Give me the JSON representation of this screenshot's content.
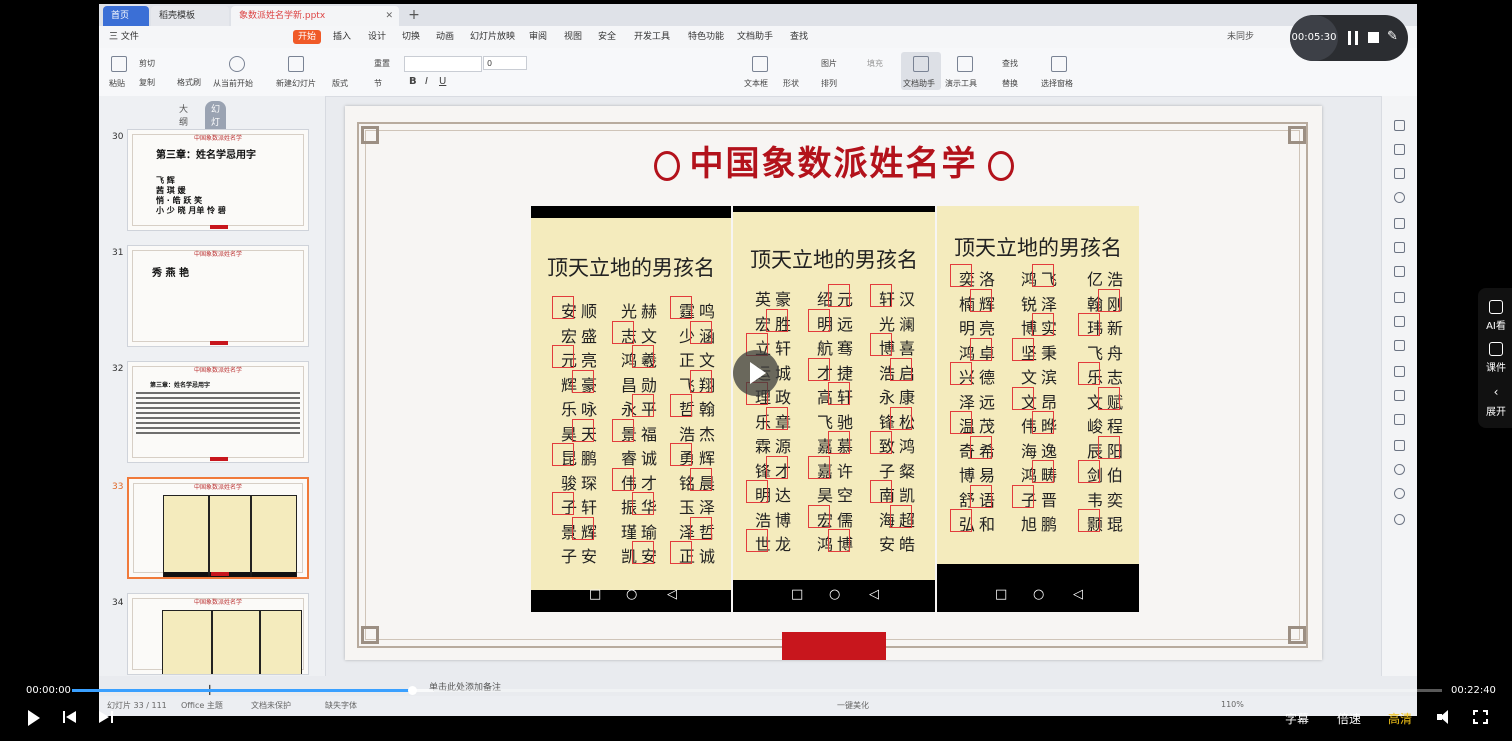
{
  "tabs": {
    "home": "首页",
    "wps": "稻壳模板",
    "doc": "象数派姓名学新.pptx"
  },
  "menu": [
    "三 文件",
    "开始",
    "插入",
    "设计",
    "切换",
    "动画",
    "幻灯片放映",
    "审阅",
    "视图",
    "安全",
    "开发工具",
    "特色功能",
    "文档助手",
    "查找"
  ],
  "menu_right": "未同步",
  "ribbon": {
    "paste": "粘贴",
    "cut": "剪切",
    "copy": "复制",
    "format": "格式刷",
    "from_start": "从当前开始",
    "new_slide": "新建幻灯片",
    "layout": "版式",
    "section": "节",
    "reset": "重置",
    "font_size": "0",
    "textbox": "文本框",
    "shape": "形状",
    "arrange": "排列",
    "picture": "图片",
    "fill": "填充",
    "doc_assist": "文档助手",
    "present_tools": "演示工具",
    "find": "查找",
    "replace": "替换",
    "select_pane": "选择窗格"
  },
  "panel": {
    "outline": "大纲",
    "slides": "幻灯片"
  },
  "thumbs": [
    {
      "num": "30",
      "title": "中国象数派姓名学",
      "text": [
        "第三章：姓名学忌用字",
        "",
        "飞 辉",
        "茜 琪 媛",
        "悄 · 皓 跃 笑",
        "小 少 晓 月单 怜 碧"
      ]
    },
    {
      "num": "31",
      "title": "中国象数派姓名学",
      "text": [
        "秀 燕 艳"
      ]
    },
    {
      "num": "32",
      "title": "中国象数派姓名学",
      "text": [
        "第三章：姓名学忌用字"
      ]
    },
    {
      "num": "33",
      "title": "中国象数派姓名学",
      "text": []
    },
    {
      "num": "34",
      "title": "中国象数派姓名学",
      "text": []
    }
  ],
  "slide": {
    "title": "中国象数派姓名学"
  },
  "phones": [
    {
      "heading": "顶天立地的男孩名",
      "rows": [
        [
          "安顺",
          "光赫",
          "霆鸣"
        ],
        [
          "宏盛",
          "志文",
          "少涵"
        ],
        [
          "元亮",
          "鸿羲",
          "正文"
        ],
        [
          "辉豪",
          "昌勋",
          "飞翔"
        ],
        [
          "乐咏",
          "永平",
          "哲翰"
        ],
        [
          "昊天",
          "景福",
          "浩杰"
        ],
        [
          "昆鹏",
          "睿诚",
          "勇辉"
        ],
        [
          "骏琛",
          "伟才",
          "铭晨"
        ],
        [
          "子轩",
          "振华",
          "玉泽"
        ],
        [
          "景辉",
          "瑾瑜",
          "泽哲"
        ],
        [
          "子安",
          "凯安",
          "正诚"
        ]
      ]
    },
    {
      "heading": "顶天立地的男孩名",
      "rows": [
        [
          "英豪",
          "绍元",
          "轩汉"
        ],
        [
          "宏胜",
          "明远",
          "光澜"
        ],
        [
          "立轩",
          "航骞",
          "博喜"
        ],
        [
          "运城",
          "才捷",
          "浩启"
        ],
        [
          "理政",
          "高轩",
          "永康"
        ],
        [
          "乐章",
          "飞驰",
          "锋松"
        ],
        [
          "霖源",
          "嘉慕",
          "致鸿"
        ],
        [
          "锋才",
          "嘉许",
          "子粲"
        ],
        [
          "明达",
          "昊空",
          "南凯"
        ],
        [
          "浩博",
          "宏儒",
          "海超"
        ],
        [
          "世龙",
          "鸿博",
          "安皓"
        ]
      ]
    },
    {
      "heading": "顶天立地的男孩名",
      "rows": [
        [
          "奕洛",
          "鸿飞",
          "亿浩"
        ],
        [
          "楠辉",
          "锐泽",
          "翰刚"
        ],
        [
          "明亮",
          "博实",
          "玮新"
        ],
        [
          "鸿卓",
          "坚秉",
          "飞舟"
        ],
        [
          "兴德",
          "文滨",
          "乐志"
        ],
        [
          "泽远",
          "文昂",
          "文赋"
        ],
        [
          "温茂",
          "伟晔",
          "峻程"
        ],
        [
          "奇希",
          "海逸",
          "辰阳"
        ],
        [
          "博易",
          "鸿畴",
          "剑伯"
        ],
        [
          "舒语",
          "子晋",
          "韦奕"
        ],
        [
          "弘和",
          "旭鹏",
          "颢琨"
        ]
      ]
    }
  ],
  "notes": "单击此处添加备注",
  "status": {
    "slide_count": "幻灯片 33 / 111",
    "theme": "Office 主题",
    "protect": "文档未保护",
    "missing_font": "缺失字体",
    "beautify": "一键美化",
    "zoom": "110%"
  },
  "recorder": {
    "time": "00:05:30"
  },
  "sidepanel": {
    "ai": "AI看",
    "courseware": "课件",
    "expand": "展开"
  },
  "player": {
    "current": "00:00:00",
    "total": "00:22:40",
    "subtitle": "字幕",
    "speed": "倍速",
    "quality": "高清",
    "progress": 0.248
  }
}
